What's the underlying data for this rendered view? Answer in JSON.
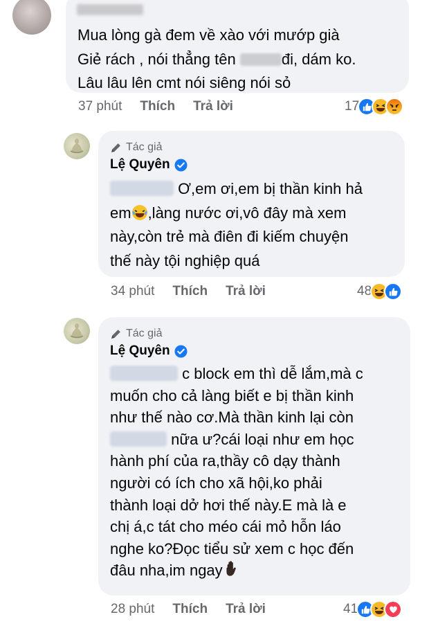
{
  "comment1": {
    "lines": [
      "Mua lòng gà đem về xào với mướp già",
      "Giẻ rách , nói thẳng tên",
      "đi, dám ko.",
      "Lâu lâu lên cmt nói siêng nói sỏ"
    ],
    "time": "37 phút",
    "like_label": "Thích",
    "reply_label": "Trả lời",
    "reaction_count": "17",
    "reactions": [
      "like-icon",
      "haha-icon",
      "angry-icon"
    ]
  },
  "comment2": {
    "author_badge": "Tác giả",
    "author_name": "Lệ Quyên",
    "lines": [
      "Ơ,em ơi,em bị thần kinh hả",
      "em",
      ",làng nước ơi,vô đây mà xem",
      "này,còn trẻ mà điên đi kiếm chuyện",
      "thế này tội nghiệp quá"
    ],
    "time": "34 phút",
    "like_label": "Thích",
    "reply_label": "Trả lời",
    "reaction_count": "48",
    "reactions": [
      "haha-icon",
      "like-icon"
    ]
  },
  "comment3": {
    "author_badge": "Tác giả",
    "author_name": "Lệ Quyên",
    "lines": [
      "c block em thì dễ lắm,mà c",
      "muốn cho cả làng biết e bị thần kinh",
      "như thế nào cơ.Mà thần kinh lại còn",
      "nữa ư?cái loại như em học",
      "hành phí của ra,thầy cô dạy thành",
      "người có ích cho xã hội,ko phải",
      "thành loại dở hơi thế này.E mà là e",
      "chị á,c tát cho méo cái mỏ hỗn láo",
      "nghe ko?Đọc tiểu sử xem c học đến",
      "đâu nha,im ngay"
    ],
    "time": "28 phút",
    "like_label": "Thích",
    "reply_label": "Trả lời",
    "reaction_count": "41",
    "reactions": [
      "like-icon",
      "haha-icon",
      "love-icon"
    ]
  },
  "colors": {
    "bubble": "#f0f2f5",
    "meta_text": "#65676b",
    "like_blue": "#1877f2",
    "verified_blue": "#1877f2",
    "love_red": "#f33e58",
    "haha_yellow": "#f7b928"
  }
}
